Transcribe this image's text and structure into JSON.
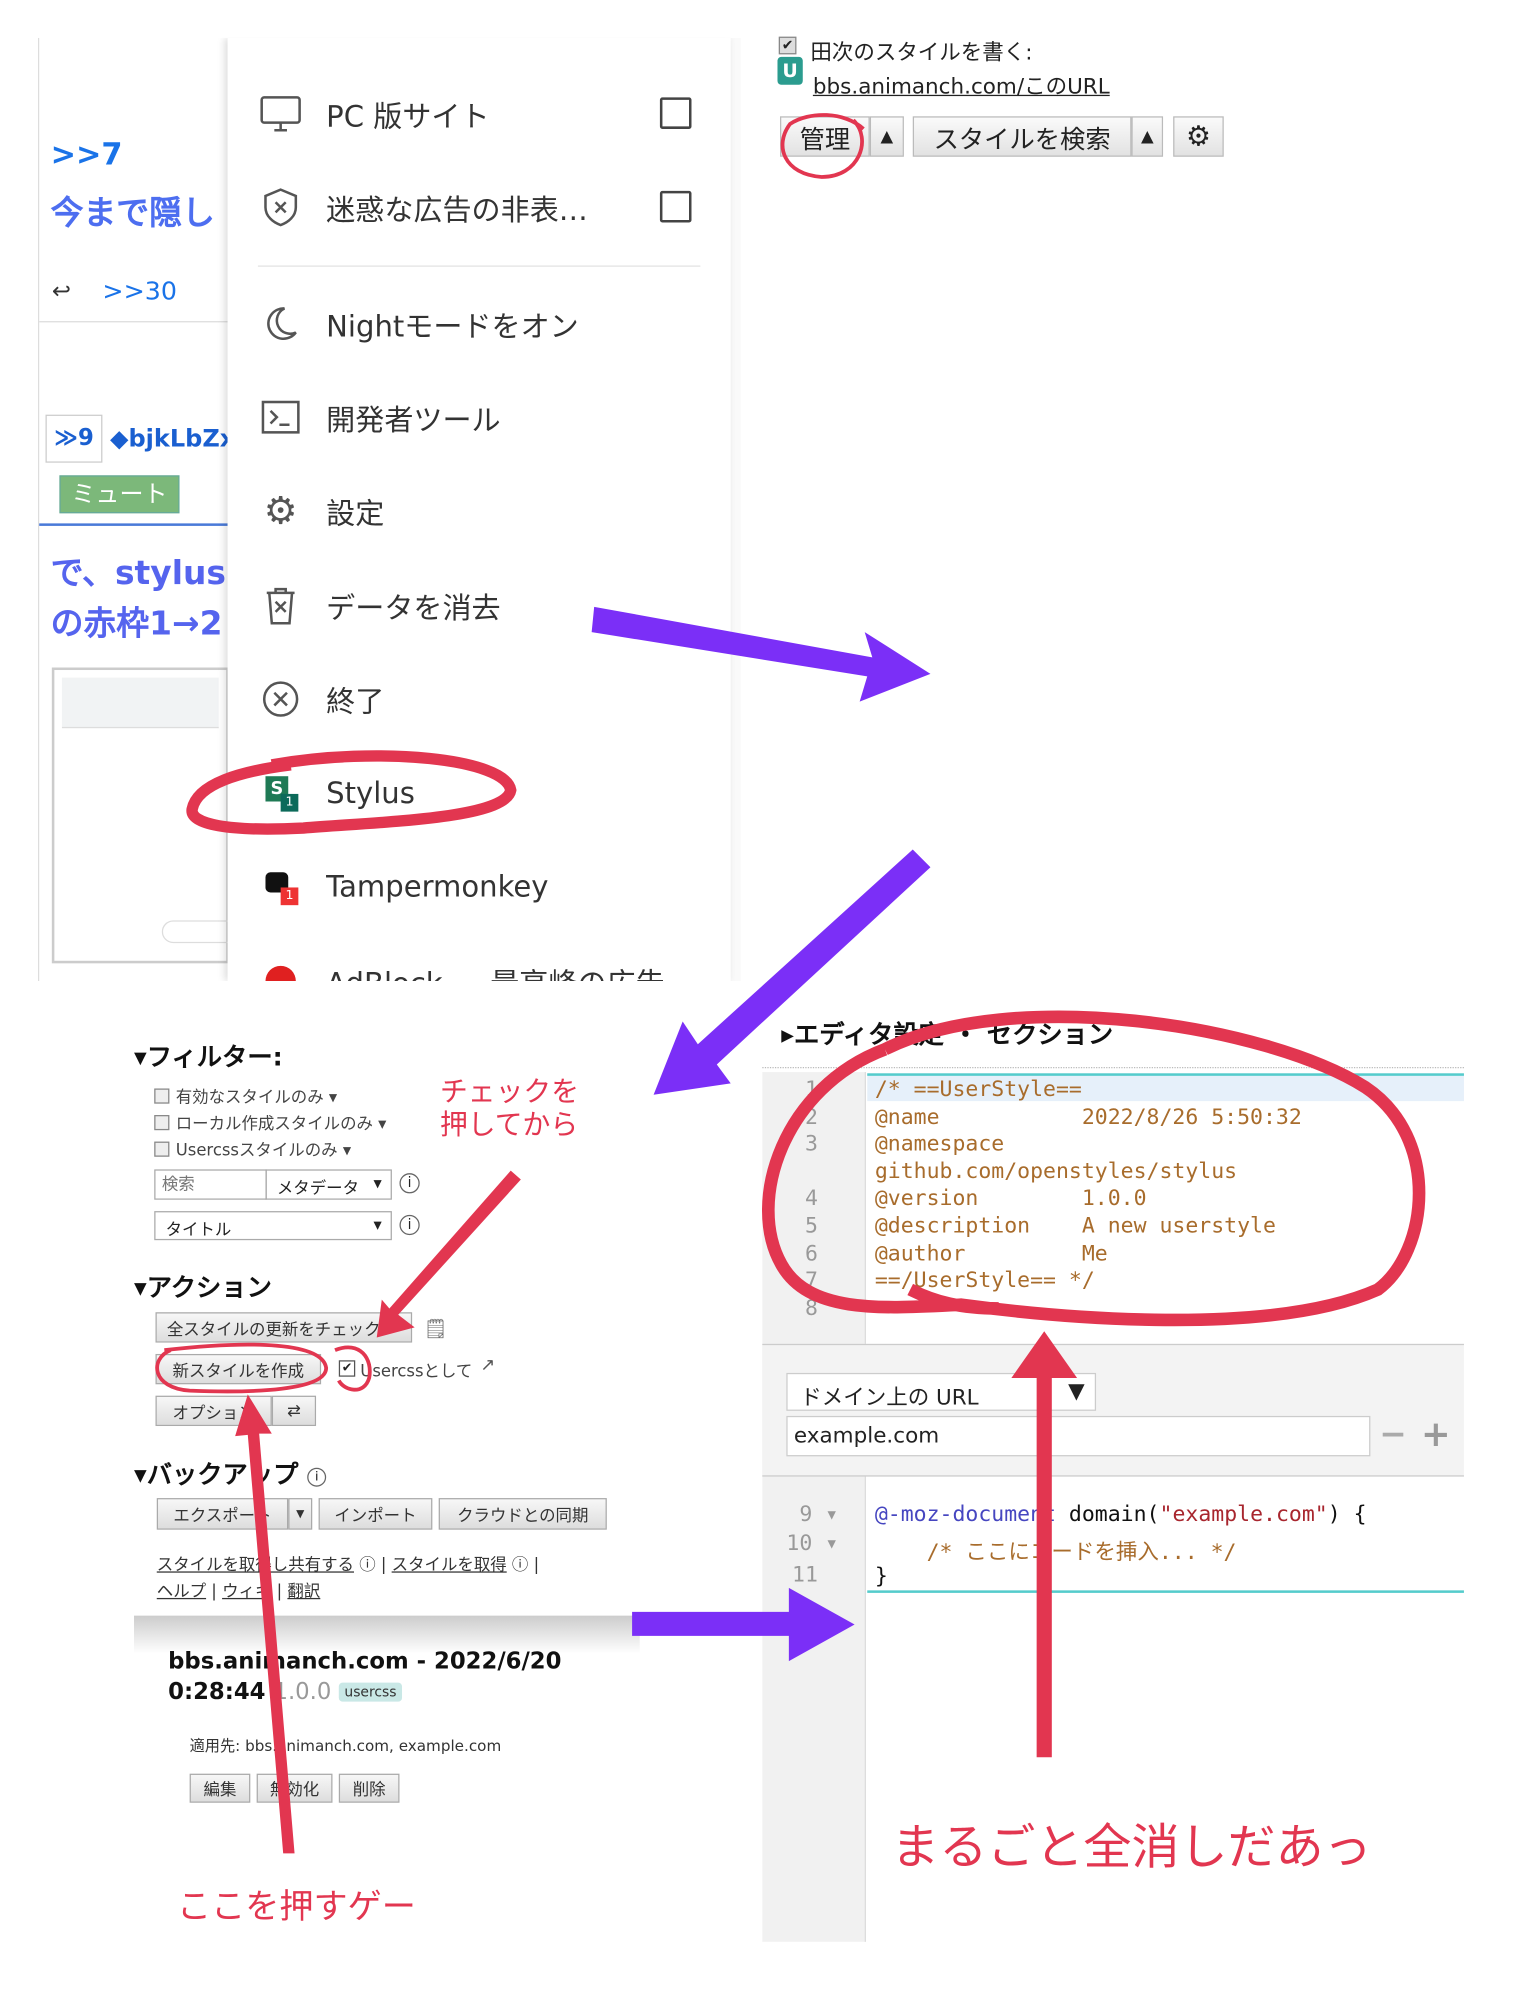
{
  "browser_menu": {
    "background_page": {
      "quote_ref": ">>7",
      "quote_text": "今まで隠し",
      "reply_ref": ">>30",
      "post_number": "≫9",
      "post_id": "◆bjkLbZx",
      "mute_button": "ミュート",
      "body_line1": "で、stylus",
      "body_line2": "の赤枠1→2"
    },
    "items": [
      {
        "label": "PC 版サイト",
        "icon": "desktop-icon",
        "checkbox": false
      },
      {
        "label": "迷惑な広告の非表…",
        "icon": "shield-x-icon",
        "checkbox": false
      },
      {
        "label": "Nightモードをオン",
        "icon": "moon-icon"
      },
      {
        "label": "開発者ツール",
        "icon": "terminal-icon"
      },
      {
        "label": "設定",
        "icon": "gear-icon"
      },
      {
        "label": "データを消去",
        "icon": "trash-icon"
      },
      {
        "label": "終了",
        "icon": "exit-icon"
      },
      {
        "label": "Stylus",
        "icon": "stylus-icon",
        "badge": "1"
      },
      {
        "label": "Tampermonkey",
        "icon": "tampermonkey-icon",
        "badge": "1"
      },
      {
        "label": "AdBlock — 最高峰の広告",
        "icon": "adblock-icon"
      }
    ]
  },
  "stylus_popup": {
    "write_style_label": "田次のスタイルを書く:",
    "u_badge": "U",
    "url_link": "bbs.animanch.com/このURL",
    "manage_button": "管理",
    "find_styles_button": "スタイルを検索",
    "arrow": "▲"
  },
  "manager": {
    "filter_heading": "▾フィルター:",
    "filters": [
      "有効なスタイルのみ ▾",
      "ローカル作成スタイルのみ ▾",
      "Usercssスタイルのみ ▾"
    ],
    "search_placeholder": "検索",
    "search_type": "メタデータ",
    "sort_select": "タイトル",
    "actions_heading": "▾アクション",
    "check_updates_button": "全スタイルの更新をチェック",
    "new_style_button": "新スタイルを作成",
    "as_usercss_label": "Usercssとして",
    "as_usercss_checked": true,
    "options_button": "オプション",
    "backup_heading": "▾バックアップ",
    "export_button": "エクスポート",
    "import_button": "インポート",
    "cloud_sync_button": "クラウドとの同期",
    "links": [
      "スタイルを取得し共有する",
      "スタイルを取得",
      "ヘルプ",
      "ウィキ",
      "翻訳"
    ],
    "style_entry": {
      "title_line1": "bbs.animanch.com - 2022/6/20",
      "title_line2": "0:28:44",
      "version": "1.0.0",
      "badge": "usercss",
      "applies_to": "適用先: bbs.animanch.com, example.com",
      "edit_button": "編集",
      "disable_button": "無効化",
      "delete_button": "削除"
    }
  },
  "editor": {
    "settings_heading": "▸エディタ設定 ・ セクション",
    "code_top": [
      {
        "n": "1",
        "text": "/* ==UserStyle=="
      },
      {
        "n": "2",
        "text": "@name           2022/8/26 5:50:32"
      },
      {
        "n": "3",
        "text": "@namespace"
      },
      {
        "n": "",
        "text": "github.com/openstyles/stylus"
      },
      {
        "n": "4",
        "text": "@version        1.0.0"
      },
      {
        "n": "5",
        "text": "@description    A new userstyle"
      },
      {
        "n": "6",
        "text": "@author         Me"
      },
      {
        "n": "7",
        "text": "==/UserStyle== */"
      },
      {
        "n": "8",
        "text": ""
      }
    ],
    "applies_select": "ドメイン上の URL",
    "applies_value": "example.com",
    "minus": "−",
    "plus": "+",
    "code_bottom": {
      "n9": "9 ▾",
      "n10": "10 ▾",
      "n11": "11",
      "moz": "@-moz-document",
      "domain": " domain(",
      "str": "\"example.com\"",
      "tail": ") {",
      "comment": "    /* ここにコードを挿入... */",
      "close": "}"
    }
  },
  "annotations": {
    "check_first": [
      "チェックを",
      "押してから"
    ],
    "press_here": "ここを押すゲー",
    "delete_all": "まるごと全消しだあっ"
  },
  "colors": {
    "arrow_purple": "#7b2ff7",
    "annotation_red": "#e23650",
    "link_blue": "#1a73e8"
  }
}
